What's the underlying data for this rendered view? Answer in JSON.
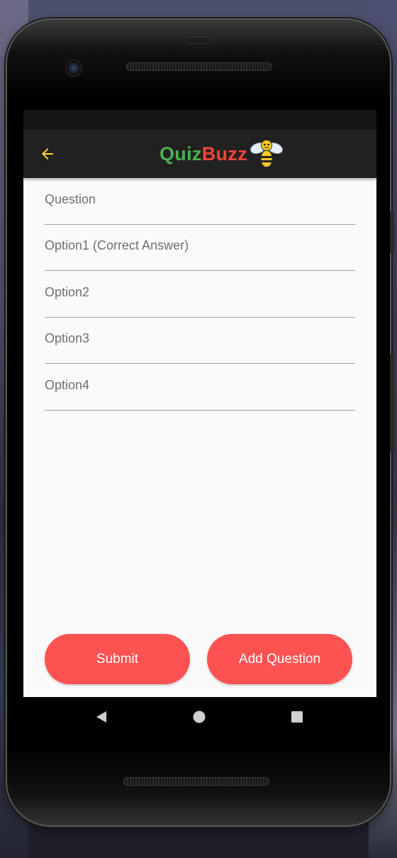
{
  "app": {
    "brand_part1": "Quiz",
    "brand_part2": "Buzz",
    "logo_icon": "bee-icon",
    "back_icon": "arrow-left-icon"
  },
  "form": {
    "question_placeholder": "Question",
    "option1_placeholder": "Option1 (Correct Answer)",
    "option2_placeholder": "Option2",
    "option3_placeholder": "Option3",
    "option4_placeholder": "Option4",
    "question_value": "",
    "option1_value": "",
    "option2_value": "",
    "option3_value": "",
    "option4_value": ""
  },
  "actions": {
    "submit_label": "Submit",
    "add_question_label": "Add Question"
  },
  "nav": {
    "back_icon": "triangle-back-icon",
    "home_icon": "circle-home-icon",
    "recents_icon": "square-recents-icon"
  },
  "colors": {
    "accent_yellow": "#fdd835",
    "quiz_green": "#4caf50",
    "buzz_red": "#f44336",
    "button_red": "#fd5252",
    "app_bar": "#212121",
    "background": "#fafafa"
  }
}
